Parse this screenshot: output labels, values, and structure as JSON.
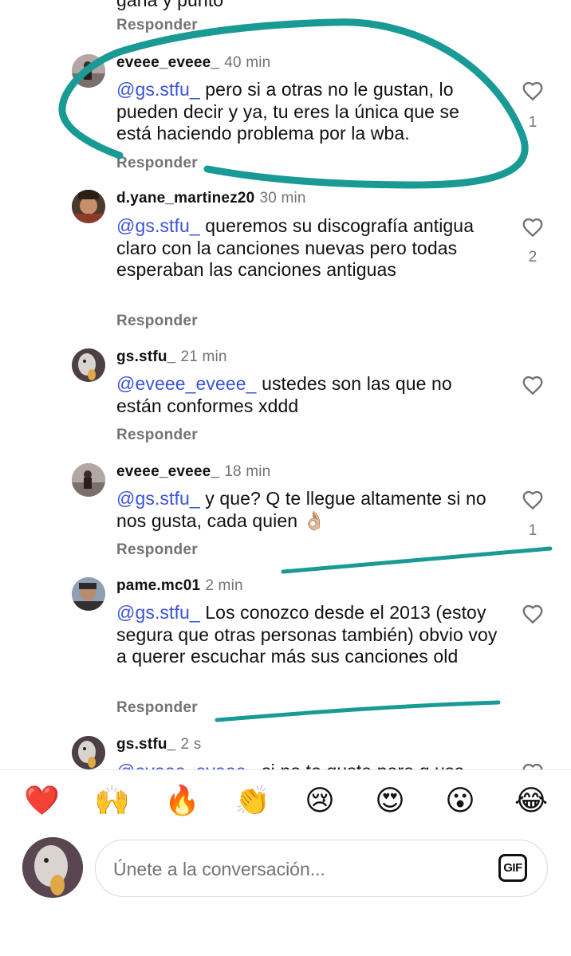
{
  "top_partial": {
    "body_fragment": "gana y punto",
    "reply_label": "Responder"
  },
  "comments": [
    {
      "username": "eveee_eveee_",
      "time": "40 min",
      "mention": "@gs.stfu_",
      "text": " pero si a otras no le gustan, lo pueden decir y ya, tu eres la única que se está haciendo problema por la wba.",
      "reply_label": "Responder",
      "likes": "1"
    },
    {
      "username": "d.yane_martinez20",
      "time": "30 min",
      "mention": "@gs.stfu_",
      "text": "  queremos su discografía antigua claro con la canciones nuevas pero todas esperaban las canciones antiguas",
      "reply_label": "Responder",
      "likes": "2"
    },
    {
      "username": "gs.stfu_",
      "time": "21 min",
      "mention": "@eveee_eveee_",
      "text": " ustedes son las que no están conformes xddd",
      "reply_label": "Responder",
      "likes": ""
    },
    {
      "username": "eveee_eveee_",
      "time": "18 min",
      "mention": "@gs.stfu_",
      "text": " y que? Q te llegue altamente si no nos gusta, cada quien 👌🏼",
      "reply_label": "Responder",
      "likes": "1"
    },
    {
      "username": "pame.mc01",
      "time": "2 min",
      "mention": "@gs.stfu_",
      "text": " Los conozco desde el 2013 (estoy segura que otras personas también) obvio voy a querer escuchar más sus canciones old",
      "reply_label": "Responder",
      "likes": ""
    },
    {
      "username": "gs.stfu_",
      "time": "2 s",
      "mention": "@eveee_eveee_",
      "text": " si no te gusta para q usa",
      "reply_label": "",
      "likes": ""
    }
  ],
  "reactions": [
    "❤️",
    "🙌",
    "🔥",
    "👏",
    "😢",
    "😍",
    "😮",
    "😂"
  ],
  "composer": {
    "placeholder": "Únete a la conversación...",
    "gif_label": "GIF"
  },
  "colors": {
    "mention": "#3c54d6",
    "secondary_text": "#737373",
    "annotation_stroke": "#1a9a94"
  },
  "icons": {
    "like": "heart-outline-icon",
    "gif": "gif-icon"
  }
}
